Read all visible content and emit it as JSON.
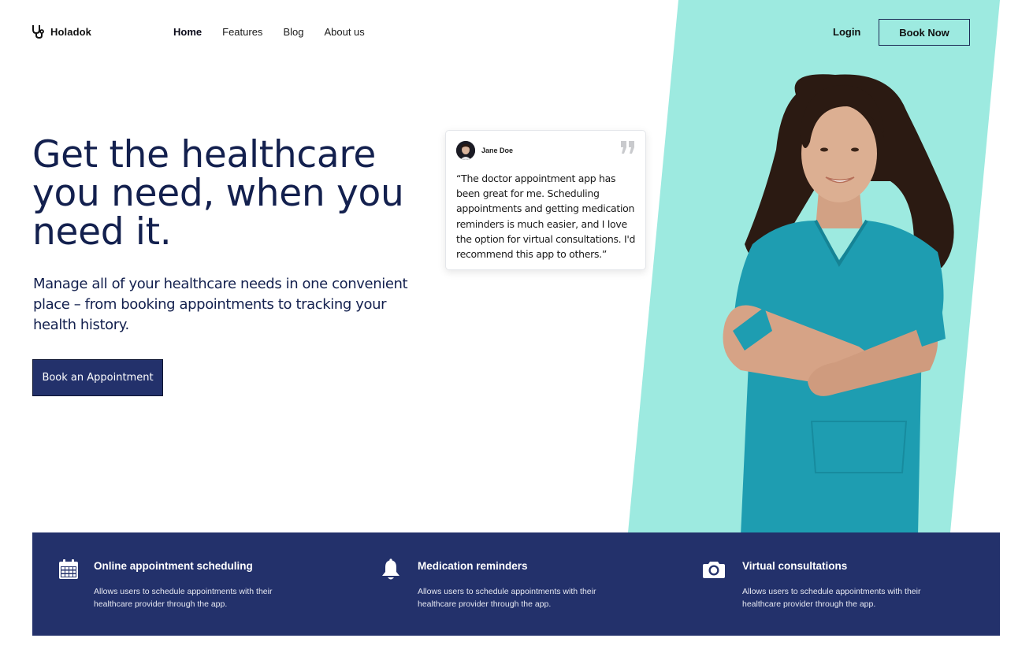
{
  "brand": {
    "name": "Holadok"
  },
  "nav": {
    "items": [
      {
        "label": "Home",
        "active": true
      },
      {
        "label": "Features",
        "active": false
      },
      {
        "label": "Blog",
        "active": false
      },
      {
        "label": "About us",
        "active": false
      }
    ],
    "login_label": "Login",
    "book_now_label": "Book Now"
  },
  "hero": {
    "title": "Get the healthcare you need, when you need it.",
    "subtitle": "Manage all of your healthcare needs in one convenient place – from booking appointments to tracking your health history.",
    "cta_label": "Book an Appointment"
  },
  "testimonial": {
    "name": "Jane Doe",
    "quote": "“The doctor appointment app has been great for me. Scheduling appointments and getting medication reminders is much easier, and I love the option for virtual consultations. I'd recommend this app to others.”",
    "quote_icon": "quote-icon"
  },
  "features": [
    {
      "icon": "calendar-icon",
      "title": "Online appointment scheduling",
      "description": "Allows users to schedule appointments with their healthcare provider through the app."
    },
    {
      "icon": "bell-icon",
      "title": "Medication reminders",
      "description": "Allows users to schedule appointments with their healthcare provider through the app."
    },
    {
      "icon": "camera-icon",
      "title": "Virtual consultations",
      "description": "Allows users to schedule appointments with their healthcare provider through the app."
    }
  ],
  "colors": {
    "primary_navy": "#23316b",
    "heading_navy": "#13204e",
    "teal_background": "#9deae0",
    "scrub_teal": "#1e9db1"
  }
}
